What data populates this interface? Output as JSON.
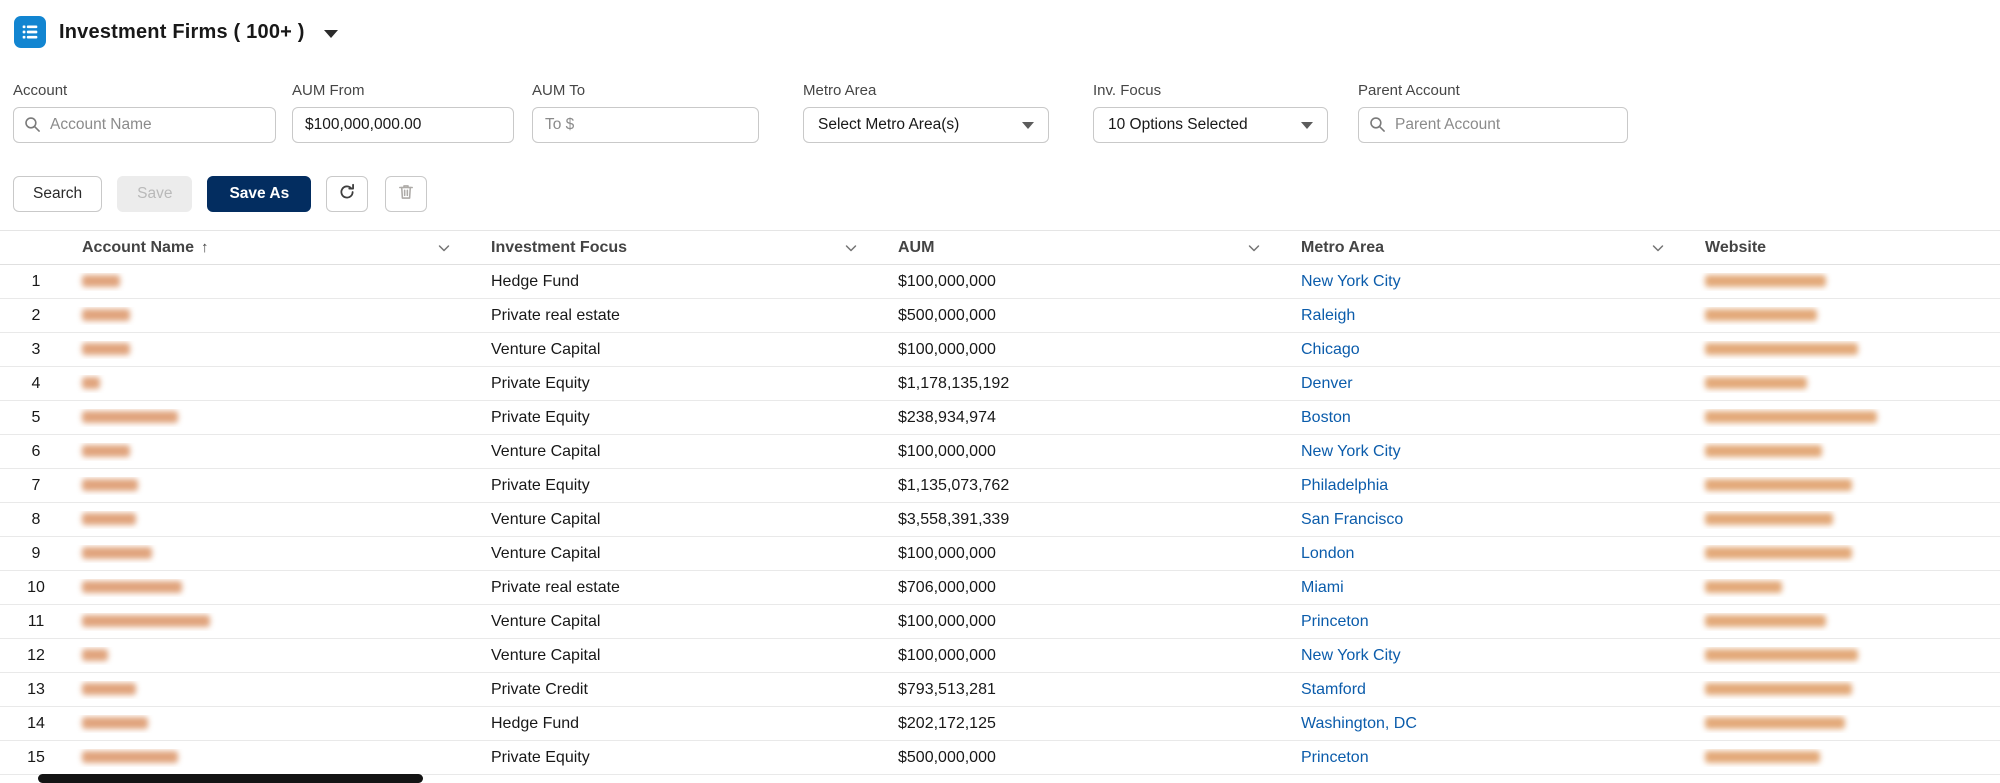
{
  "colors": {
    "brand_navy": "#032d60",
    "link_blue": "#0b5cab",
    "list_icon_blue": "#1285d1"
  },
  "header": {
    "title": "Investment Firms ( 100+ )"
  },
  "filters": {
    "account": {
      "label": "Account",
      "placeholder": "Account Name"
    },
    "aum_from": {
      "label": "AUM From",
      "value": "$100,000,000.00"
    },
    "aum_to": {
      "label": "AUM To",
      "placeholder": "To $"
    },
    "metro": {
      "label": "Metro Area",
      "value": "Select Metro Area(s)"
    },
    "inv_focus": {
      "label": "Inv. Focus",
      "value": "10 Options Selected"
    },
    "parent": {
      "label": "Parent Account",
      "placeholder": "Parent Account"
    }
  },
  "toolbar": {
    "search_label": "Search",
    "save_label": "Save",
    "save_as_label": "Save As"
  },
  "table": {
    "columns": [
      "Account Name",
      "Investment Focus",
      "AUM",
      "Metro Area",
      "Website"
    ],
    "sorted_column": "Account Name",
    "sort_direction": "ascending",
    "rows": [
      {
        "num": "1",
        "focus": "Hedge Fund",
        "aum": "$100,000,000",
        "metro": "New York City",
        "name_w": 38,
        "web_w": 121
      },
      {
        "num": "2",
        "focus": "Private real estate",
        "aum": "$500,000,000",
        "metro": "Raleigh",
        "name_w": 48,
        "web_w": 112
      },
      {
        "num": "3",
        "focus": "Venture Capital",
        "aum": "$100,000,000",
        "metro": "Chicago",
        "name_w": 48,
        "web_w": 153
      },
      {
        "num": "4",
        "focus": "Private Equity",
        "aum": "$1,178,135,192",
        "metro": "Denver",
        "name_w": 18,
        "web_w": 102
      },
      {
        "num": "5",
        "focus": "Private Equity",
        "aum": "$238,934,974",
        "metro": "Boston",
        "name_w": 96,
        "web_w": 172
      },
      {
        "num": "6",
        "focus": "Venture Capital",
        "aum": "$100,000,000",
        "metro": "New York City",
        "name_w": 48,
        "web_w": 117
      },
      {
        "num": "7",
        "focus": "Private Equity",
        "aum": "$1,135,073,762",
        "metro": "Philadelphia",
        "name_w": 56,
        "web_w": 147
      },
      {
        "num": "8",
        "focus": "Venture Capital",
        "aum": "$3,558,391,339",
        "metro": "San Francisco",
        "name_w": 54,
        "web_w": 128
      },
      {
        "num": "9",
        "focus": "Venture Capital",
        "aum": "$100,000,000",
        "metro": "London",
        "name_w": 70,
        "web_w": 147
      },
      {
        "num": "10",
        "focus": "Private real estate",
        "aum": "$706,000,000",
        "metro": "Miami",
        "name_w": 100,
        "web_w": 77
      },
      {
        "num": "11",
        "focus": "Venture Capital",
        "aum": "$100,000,000",
        "metro": "Princeton",
        "name_w": 128,
        "web_w": 121
      },
      {
        "num": "12",
        "focus": "Venture Capital",
        "aum": "$100,000,000",
        "metro": "New York City",
        "name_w": 26,
        "web_w": 153
      },
      {
        "num": "13",
        "focus": "Private Credit",
        "aum": "$793,513,281",
        "metro": "Stamford",
        "name_w": 54,
        "web_w": 147
      },
      {
        "num": "14",
        "focus": "Hedge Fund",
        "aum": "$202,172,125",
        "metro": "Washington, DC",
        "name_w": 66,
        "web_w": 140
      },
      {
        "num": "15",
        "focus": "Private Equity",
        "aum": "$500,000,000",
        "metro": "Princeton",
        "name_w": 96,
        "web_w": 115
      }
    ]
  }
}
